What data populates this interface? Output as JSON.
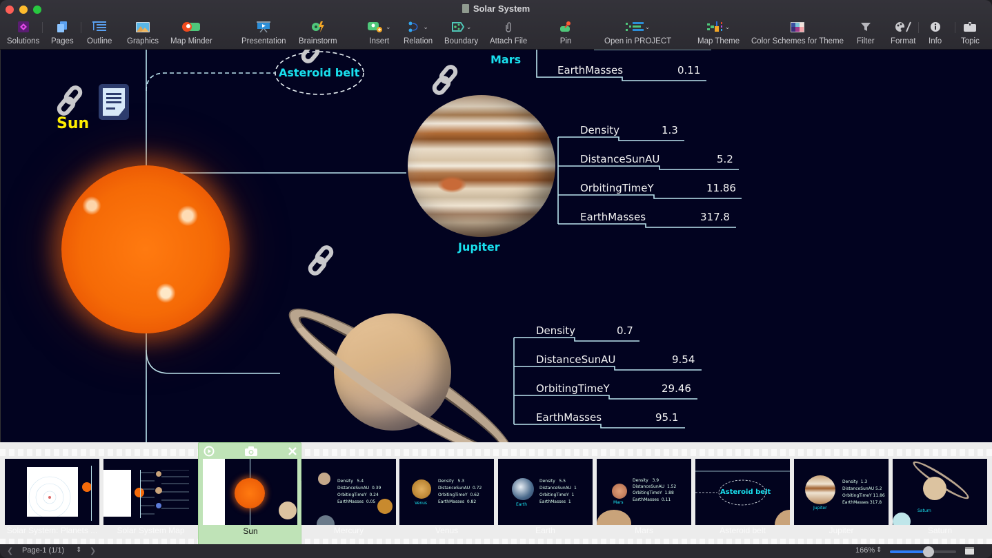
{
  "window": {
    "title": "Solar System",
    "controls": [
      "close",
      "minimize",
      "maximize"
    ]
  },
  "toolbar": {
    "items": [
      {
        "id": "solutions",
        "label": "Solutions",
        "icon": "solutions-icon"
      },
      {
        "id": "pages",
        "label": "Pages",
        "icon": "pages-icon"
      },
      {
        "id": "outline",
        "label": "Outline",
        "icon": "outline-icon"
      },
      {
        "id": "graphics",
        "label": "Graphics",
        "icon": "graphics-icon"
      },
      {
        "id": "map-minder",
        "label": "Map Minder",
        "icon": "map-minder-icon"
      },
      {
        "id": "presentation",
        "label": "Presentation",
        "icon": "presentation-icon"
      },
      {
        "id": "brainstorm",
        "label": "Brainstorm",
        "icon": "brainstorm-icon"
      },
      {
        "id": "insert",
        "label": "Insert",
        "icon": "insert-icon",
        "dropdown": true
      },
      {
        "id": "relation",
        "label": "Relation",
        "icon": "relation-icon",
        "dropdown": true
      },
      {
        "id": "boundary",
        "label": "Boundary",
        "icon": "boundary-icon",
        "dropdown": true
      },
      {
        "id": "attach-file",
        "label": "Attach File",
        "icon": "paperclip-icon"
      },
      {
        "id": "pin",
        "label": "Pin",
        "icon": "pin-icon"
      },
      {
        "id": "open-in-project",
        "label": "Open in PROJECT",
        "icon": "project-icon",
        "dropdown": true
      },
      {
        "id": "map-theme",
        "label": "Map Theme",
        "icon": "map-theme-icon",
        "dropdown": true
      },
      {
        "id": "color-schemes",
        "label": "Color Schemes for Theme",
        "icon": "color-scheme-icon"
      },
      {
        "id": "filter",
        "label": "Filter",
        "icon": "filter-icon"
      },
      {
        "id": "format",
        "label": "Format",
        "icon": "palette-icon"
      },
      {
        "id": "info",
        "label": "Info",
        "icon": "info-icon"
      },
      {
        "id": "topic",
        "label": "Topic",
        "icon": "topic-icon"
      }
    ]
  },
  "map": {
    "colors": {
      "background": "#020320",
      "connector": "#bde6f0",
      "planet_label": "#19e0ee",
      "sun_label": "#ffee00",
      "property_text": "#f2f2f2"
    },
    "sun": {
      "label": "Sun",
      "has_link": true,
      "has_note": true
    },
    "asteroid_belt": {
      "label": "Asteroid belt"
    },
    "mars": {
      "label": "Mars",
      "visible_properties": [
        {
          "name": "EarthMasses",
          "value": "0.11"
        }
      ]
    },
    "jupiter": {
      "label": "Jupiter",
      "has_link": true,
      "properties": [
        {
          "name": "Density",
          "value": "1.3"
        },
        {
          "name": "DistanceSunAU",
          "value": "5.2"
        },
        {
          "name": "OrbitingTimeY",
          "value": "11.86"
        },
        {
          "name": "EarthMasses",
          "value": "317.8"
        }
      ]
    },
    "saturn": {
      "label": "Saturn",
      "has_link": true,
      "properties": [
        {
          "name": "Density",
          "value": "0.7"
        },
        {
          "name": "DistanceSunAU",
          "value": "9.54"
        },
        {
          "name": "OrbitingTimeY",
          "value": "29.46"
        },
        {
          "name": "EarthMasses",
          "value": "95.1"
        }
      ]
    }
  },
  "filmstrip": {
    "slides": [
      {
        "label": "Solar System: Planets ...",
        "selected": false
      },
      {
        "label": "Solar System Map",
        "selected": false
      },
      {
        "label": "Sun",
        "selected": true
      },
      {
        "label": "Mercury",
        "selected": false
      },
      {
        "label": "Venus",
        "selected": false
      },
      {
        "label": "Earth",
        "selected": false
      },
      {
        "label": "Mars",
        "selected": false
      },
      {
        "label": "Asteroid belt",
        "selected": false
      },
      {
        "label": "Jupiter",
        "selected": false
      },
      {
        "label": "Saturn",
        "selected": false
      }
    ],
    "selected_controls": {
      "play": "play-icon",
      "snapshot": "camera-icon",
      "remove": "close-icon"
    },
    "add_label": "+",
    "thumb_texts": {
      "mercury": [
        [
          "Density",
          "5.4"
        ],
        [
          "DistanceSunAU",
          "0.39"
        ],
        [
          "OrbitingTimeY",
          "0.24"
        ],
        [
          "EarthMasses",
          "0.05"
        ]
      ],
      "venus": [
        [
          "Density",
          "5.3"
        ],
        [
          "DistanceSunAU",
          "0.72"
        ],
        [
          "OrbitingTimeY",
          "0.62"
        ],
        [
          "EarthMasses",
          "0.82"
        ]
      ],
      "earth": [
        [
          "Density",
          "5.5"
        ],
        [
          "DistanceSunAU",
          "1"
        ],
        [
          "OrbitingTimeY",
          "1"
        ],
        [
          "EarthMasses",
          "1"
        ]
      ],
      "mars": [
        [
          "Density",
          "3.9"
        ],
        [
          "DistanceSunAU",
          "1.52"
        ],
        [
          "OrbitingTimeY",
          "1.88"
        ],
        [
          "EarthMasses",
          "0.11"
        ]
      ]
    }
  },
  "statusbar": {
    "page_label": "Page-1 (1/1)",
    "zoom_label": "166%",
    "zoom_slider_fraction": 0.58
  }
}
